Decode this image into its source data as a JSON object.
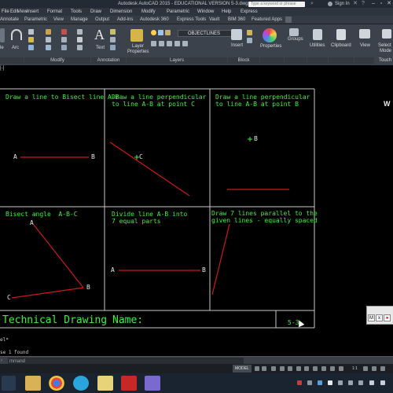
{
  "titlebar": {
    "title": "Autodesk AutoCAD 2015 - EDUCATIONAL VERSION    5-3.dwg",
    "search_placeholder": "Type a keyword or phrase",
    "signin": "Sign In"
  },
  "menubar": {
    "items": [
      "File",
      "Edit",
      "View",
      "Insert",
      "Format",
      "Tools",
      "Draw",
      "Dimension",
      "Modify",
      "Parametric",
      "Window",
      "Help",
      "Express"
    ]
  },
  "tabs": {
    "items": [
      "Annotate",
      "Parametric",
      "View",
      "Manage",
      "Output",
      "Add-ins",
      "Autodesk 360",
      "Express Tools",
      "Vault",
      "BIM 360",
      "Featured Apps"
    ]
  },
  "ribbon": {
    "draw_partial": "le",
    "arc": "Arc",
    "modify_title": "Modify",
    "text": "Text",
    "annotation_title": "Annotation",
    "layer_props_1": "Layer",
    "layer_props_2": "Properties",
    "layer_current": "OBJECTLINES",
    "layers_title": "Layers",
    "insert": "Insert",
    "block_title": "Block",
    "properties": "Properties",
    "groups": "Groups",
    "utilities": "Utilities",
    "clipboard": "Clipboard",
    "view": "View",
    "select_1": "Select",
    "select_2": "Mode",
    "touch": "Touch"
  },
  "drawing": {
    "view_label": "[-]",
    "cells": {
      "c1": "Draw a line to Bisect line A-B",
      "c2": "Draw a line perpendicular\nto line A-B at point C",
      "c3": "Draw a line perpendicular\nto line A-B at point B",
      "c4": "Bisect angle  A-B-C",
      "c5": "Divide line A-B into\n7 equal parts",
      "c6": "Draw 7 lines parallel to the\ngiven lines - equally spaced"
    },
    "points": {
      "p1a": "A",
      "p1b": "B",
      "p2c": "C",
      "p3b": "B",
      "p4a": "A",
      "p4b": "B",
      "p4c": "C",
      "p5a": "A",
      "p5b": "B"
    },
    "title_left": "Technical Drawing",
    "title_name": "Name:",
    "sheet": "5-3",
    "cube_letter": "W",
    "mx_buttons": [
      "M",
      "x",
      "●"
    ]
  },
  "command": {
    "history_1": "el*",
    "history_2": "se 1 found",
    "placeholder": "mmand"
  },
  "status": {
    "model": "MODEL",
    "scale": "1:1"
  },
  "colors": {
    "green": "#3df03d",
    "red": "#d01818",
    "border": "#c8c8c8"
  }
}
